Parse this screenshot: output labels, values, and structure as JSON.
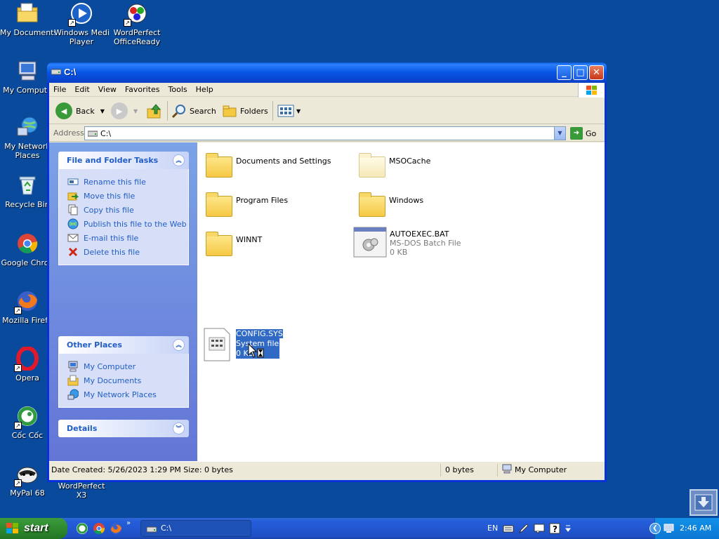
{
  "desktop": {
    "icons": [
      {
        "label": "My Documents",
        "icon": "my-documents-icon"
      },
      {
        "label": "Windows Media Player",
        "line1": "Windows Media",
        "line2": "Player",
        "icon": "media-player-icon"
      },
      {
        "label": "WordPerfect OfficeReady",
        "line1": "WordPerfect",
        "line2": "OfficeReady",
        "icon": "wordperfect-officeready-icon"
      },
      {
        "label": "My Compute",
        "icon": "my-computer-icon"
      },
      {
        "label": "My Network Places",
        "line1": "My Network",
        "line2": "Places",
        "icon": "network-places-icon"
      },
      {
        "label": "Recycle Bin",
        "icon": "recycle-bin-icon"
      },
      {
        "label": "Google Chron",
        "icon": "chrome-icon"
      },
      {
        "label": "Mozilla Firefo",
        "icon": "firefox-icon"
      },
      {
        "label": "Opera",
        "icon": "opera-icon"
      },
      {
        "label": "Cốc Cốc",
        "icon": "coccoc-icon"
      },
      {
        "label": "MyPal 68",
        "icon": "mypal-icon"
      },
      {
        "label": "WordPerfect X3",
        "line1": "WordPerfect",
        "line2": "X3",
        "icon": "wordperfect-x3-icon"
      }
    ]
  },
  "window": {
    "title": "C:\\",
    "menu": [
      "File",
      "Edit",
      "View",
      "Favorites",
      "Tools",
      "Help"
    ],
    "toolbar": {
      "back": "Back",
      "search": "Search",
      "folders": "Folders"
    },
    "address": {
      "label": "Address",
      "value": "C:\\",
      "go": "Go"
    },
    "tasks_panel": {
      "title": "File and Folder Tasks",
      "items": [
        "Rename this file",
        "Move this file",
        "Copy this file",
        "Publish this file to the Web",
        "E-mail this file",
        "Delete this file"
      ]
    },
    "places_panel": {
      "title": "Other Places",
      "items": [
        "My Computer",
        "My Documents",
        "My Network Places"
      ]
    },
    "details_panel": {
      "title": "Details"
    },
    "files": [
      {
        "name": "Documents and Settings",
        "type": "folder"
      },
      {
        "name": "MSOCache",
        "type": "folder-hidden"
      },
      {
        "name": "Program Files",
        "type": "folder"
      },
      {
        "name": "Windows",
        "type": "folder"
      },
      {
        "name": "WINNT",
        "type": "folder"
      },
      {
        "name": "AUTOEXEC.BAT",
        "type": "batch",
        "desc": "MS-DOS Batch File",
        "size": "0 KB"
      },
      {
        "name": "CONFIG.SYS",
        "type": "system",
        "desc": "System file",
        "size": "0 KB",
        "selected": true
      }
    ],
    "status": {
      "info": "Date Created: 5/26/2023 1:29 PM Size: 0 bytes",
      "size": "0 bytes",
      "zone": "My Computer"
    }
  },
  "taskbar": {
    "start": "start",
    "task_label": "C:\\",
    "language": "EN",
    "clock": "2:46 AM"
  }
}
